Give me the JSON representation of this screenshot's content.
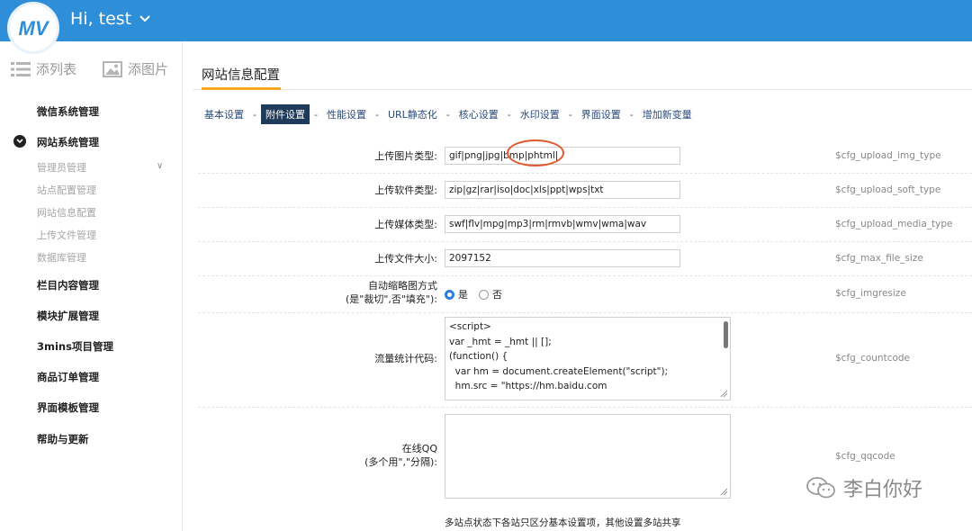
{
  "header": {
    "greeting": "Hi, test",
    "brand_color": "#2e8ed8",
    "logo_text": "MV"
  },
  "sidebar": {
    "quick_add_list": "添列表",
    "quick_add_image": "添图片",
    "items": [
      {
        "label": "微信系统管理"
      },
      {
        "label": "网站系统管理"
      },
      {
        "label": "栏目内容管理"
      },
      {
        "label": "模块扩展管理"
      },
      {
        "label": "3mins项目管理"
      },
      {
        "label": "商品订单管理"
      },
      {
        "label": "界面模板管理"
      },
      {
        "label": "帮助与更新"
      }
    ],
    "subitems": [
      {
        "label": "管理员管理"
      },
      {
        "label": "站点配置管理"
      },
      {
        "label": "网站信息配置"
      },
      {
        "label": "上传文件管理"
      },
      {
        "label": "数据库管理"
      }
    ]
  },
  "main": {
    "title": "网站信息配置",
    "title_accent_color": "#f5a623",
    "tabs": [
      {
        "label": "基本设置",
        "active": false
      },
      {
        "label": "附件设置",
        "active": true
      },
      {
        "label": "性能设置",
        "active": false
      },
      {
        "label": "URL静态化",
        "active": false
      },
      {
        "label": "核心设置",
        "active": false
      },
      {
        "label": "水印设置",
        "active": false
      },
      {
        "label": "界面设置",
        "active": false
      },
      {
        "label": "增加新变量",
        "active": false
      }
    ],
    "tab_separator": "-",
    "rows": {
      "img_type": {
        "label": "上传图片类型:",
        "value": "gif|png|jpg|bmp|phtml|",
        "var": "$cfg_upload_img_type"
      },
      "soft_type": {
        "label": "上传软件类型:",
        "value": "zip|gz|rar|iso|doc|xls|ppt|wps|txt",
        "var": "$cfg_upload_soft_type"
      },
      "media_type": {
        "label": "上传媒体类型:",
        "value": "swf|flv|mpg|mp3|rm|rmvb|wmv|wma|wav",
        "var": "$cfg_upload_media_type"
      },
      "max_size": {
        "label": "上传文件大小:",
        "value": "2097152",
        "var": "$cfg_max_file_size"
      },
      "imgresize": {
        "label_line1": "自动缩略图方式",
        "label_line2": "(是\"裁切\",否\"填充\"):",
        "opt_yes": "是",
        "opt_no": "否",
        "selected": "是",
        "var": "$cfg_imgresize"
      },
      "countcode": {
        "label": "流量统计代码:",
        "value": "<script>\nvar _hmt = _hmt || [];\n(function() {\n  var hm = document.createElement(\"script\");\n  hm.src = \"https://hm.baidu.com",
        "var": "$cfg_countcode"
      },
      "qqcode": {
        "label_line1": "在线QQ",
        "label_line2": "(多个用\",\"分隔):",
        "value": "",
        "var": "$cfg_qqcode"
      }
    },
    "footer_note": "多站点状态下各站只区分基本设置项，其他设置多站共享",
    "highlight_color": "#e0582a"
  },
  "watermark": {
    "text": "李白你好"
  }
}
